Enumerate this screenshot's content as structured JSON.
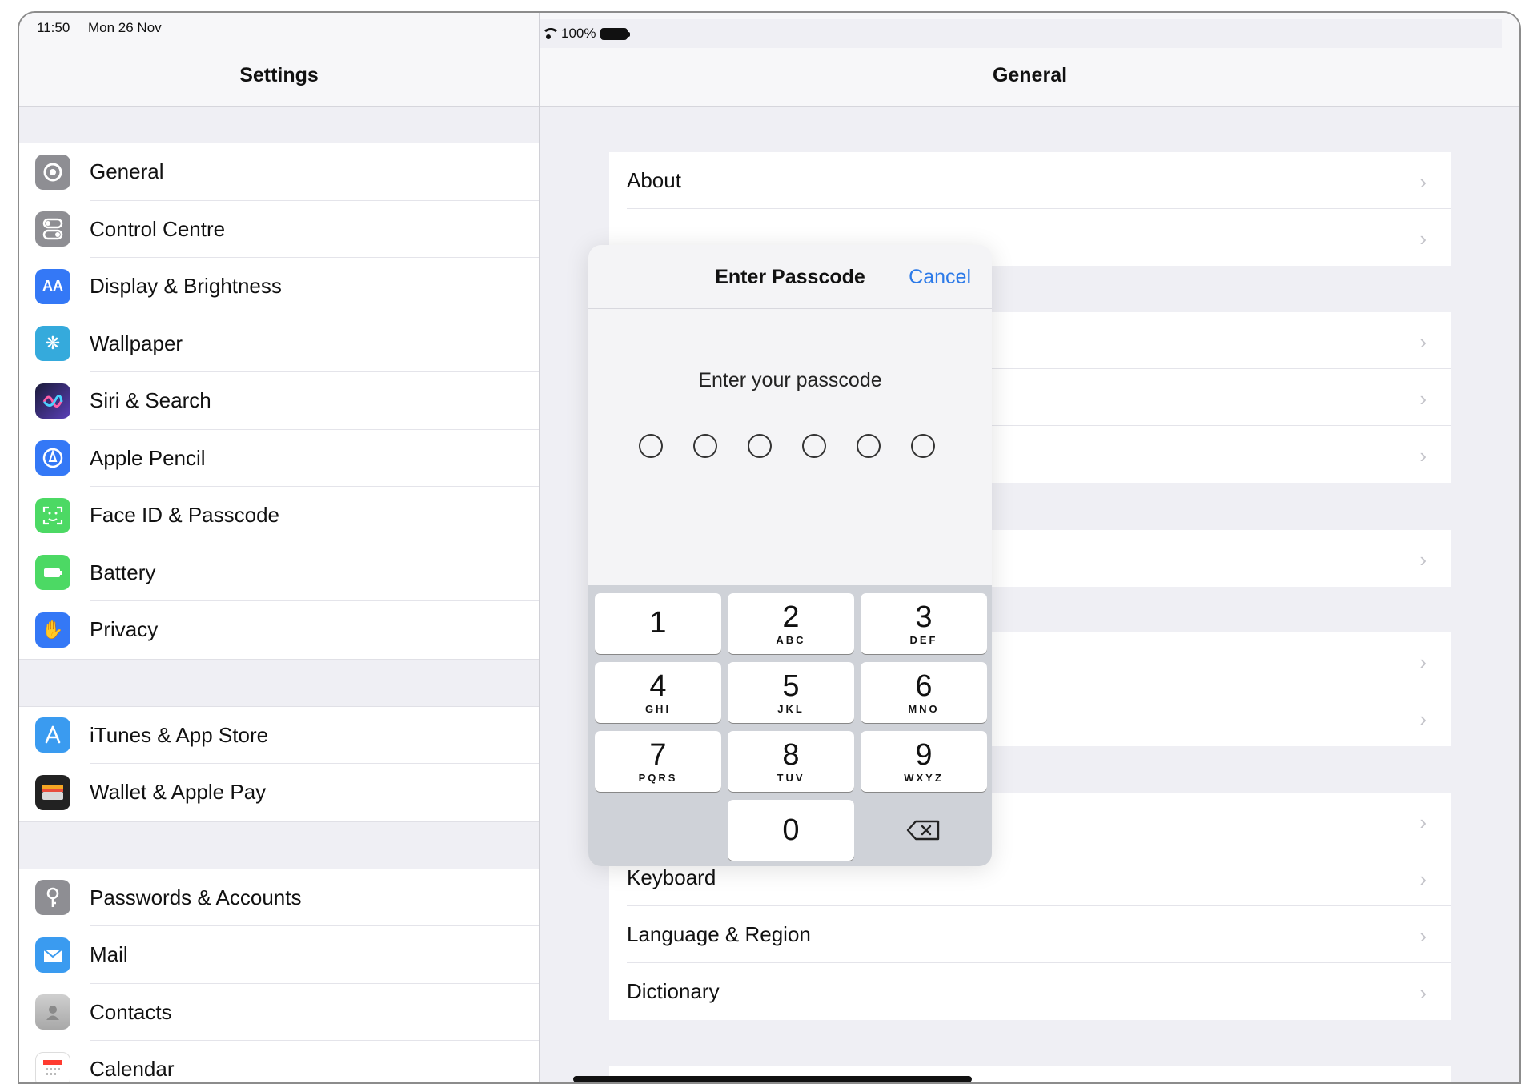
{
  "status": {
    "time": "11:50",
    "date": "Mon 26 Nov",
    "battery": "100%"
  },
  "left": {
    "title": "Settings",
    "groups": [
      [
        {
          "label": "General",
          "icon": "gear-icon",
          "color": "#8e8e93"
        },
        {
          "label": "Control Centre",
          "icon": "switches-icon",
          "color": "#8e8e93"
        },
        {
          "label": "Display & Brightness",
          "icon": "text-size-icon",
          "color": "#3478f6"
        },
        {
          "label": "Wallpaper",
          "icon": "flower-icon",
          "color": "#35aadc"
        },
        {
          "label": "Siri & Search",
          "icon": "siri-icon",
          "color": "#2b2b55"
        },
        {
          "label": "Apple Pencil",
          "icon": "pencil-icon",
          "color": "#3478f6"
        },
        {
          "label": "Face ID & Passcode",
          "icon": "face-id-icon",
          "color": "#4cd964"
        },
        {
          "label": "Battery",
          "icon": "battery-icon",
          "color": "#4cd964"
        },
        {
          "label": "Privacy",
          "icon": "hand-icon",
          "color": "#3478f6"
        }
      ],
      [
        {
          "label": "iTunes & App Store",
          "icon": "app-store-icon",
          "color": "#3a9bf0"
        },
        {
          "label": "Wallet & Apple Pay",
          "icon": "wallet-icon",
          "color": "#222222"
        }
      ],
      [
        {
          "label": "Passwords & Accounts",
          "icon": "key-icon",
          "color": "#8e8e93"
        },
        {
          "label": "Mail",
          "icon": "mail-icon",
          "color": "#3a9bf0"
        },
        {
          "label": "Contacts",
          "icon": "contacts-icon",
          "color": "#a9a9a9"
        },
        {
          "label": "Calendar",
          "icon": "calendar-icon",
          "color": "#ffffff"
        }
      ]
    ]
  },
  "right": {
    "title": "General",
    "rows": {
      "about": "About",
      "keyboard": "Keyboard",
      "language": "Language & Region",
      "dictionary": "Dictionary"
    }
  },
  "modal": {
    "title": "Enter Passcode",
    "cancel": "Cancel",
    "prompt": "Enter your passcode",
    "digits_entered": 0,
    "digits_total": 6,
    "keys": [
      {
        "num": "1",
        "letters": ""
      },
      {
        "num": "2",
        "letters": "ABC"
      },
      {
        "num": "3",
        "letters": "DEF"
      },
      {
        "num": "4",
        "letters": "GHI"
      },
      {
        "num": "5",
        "letters": "JKL"
      },
      {
        "num": "6",
        "letters": "MNO"
      },
      {
        "num": "7",
        "letters": "PQRS"
      },
      {
        "num": "8",
        "letters": "TUV"
      },
      {
        "num": "9",
        "letters": "WXYZ"
      },
      {
        "num": "0",
        "letters": ""
      }
    ]
  },
  "colors": {
    "accent": "#2c7ae8"
  }
}
